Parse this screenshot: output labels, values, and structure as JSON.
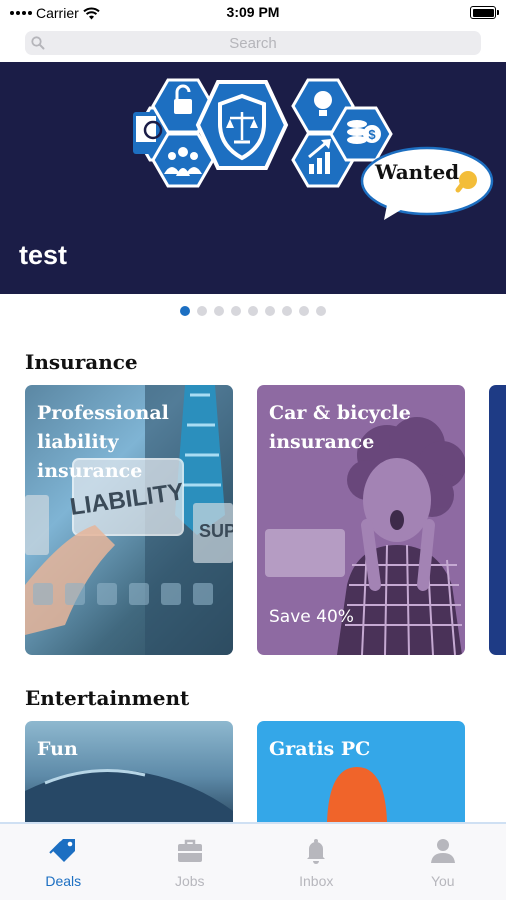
{
  "status_bar": {
    "carrier": "Carrier",
    "time": "3:09 PM"
  },
  "search": {
    "placeholder": "Search"
  },
  "hero": {
    "title": "test",
    "badge_text": "Wanted",
    "page_count": 9,
    "active_page": 1
  },
  "sections": [
    {
      "title": "Insurance",
      "cards": [
        {
          "title": "Professional liability insurance",
          "subtitle": ""
        },
        {
          "title": "Car & bicycle insurance",
          "subtitle": "Save 40%"
        }
      ]
    },
    {
      "title": "Entertainment",
      "cards": [
        {
          "title": "Fun",
          "subtitle": ""
        },
        {
          "title": "Gratis PC",
          "subtitle": ""
        }
      ]
    }
  ],
  "tabs": [
    {
      "label": "Deals",
      "icon": "tag-icon",
      "active": true
    },
    {
      "label": "Jobs",
      "icon": "briefcase-icon",
      "active": false
    },
    {
      "label": "Inbox",
      "icon": "bell-icon",
      "active": false
    },
    {
      "label": "You",
      "icon": "person-icon",
      "active": false
    }
  ],
  "colors": {
    "accent": "#1c6fc2",
    "hero_bg": "#1b1d47",
    "car_card": "#8e6aa2",
    "gratis_card": "#34a7e8",
    "tab_inactive": "#b7b7bd"
  }
}
